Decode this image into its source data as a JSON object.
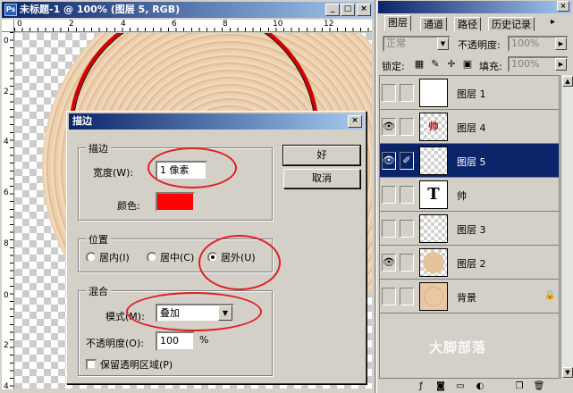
{
  "document": {
    "title": "未标题-1 @ 100% (图层 5, RGB)",
    "ruler_top": [
      "0",
      "2",
      "4",
      "6",
      "8",
      "10",
      "12"
    ],
    "ruler_left": [
      "0",
      "2",
      "4",
      "6",
      "8",
      "0",
      "2",
      "4"
    ],
    "watermark": "大脚部落"
  },
  "stroke_dialog": {
    "title": "描边",
    "ok_label": "好",
    "cancel_label": "取消",
    "stroke_group": {
      "label": "描边",
      "width_label": "宽度(W):",
      "width_value": "1 像素",
      "color_label": "颜色:",
      "color_value": "#ff0000"
    },
    "location_group": {
      "label": "位置",
      "options": [
        "居内(I)",
        "居中(C)",
        "居外(U)"
      ],
      "selected": "居外(U)"
    },
    "blending_group": {
      "label": "混合",
      "mode_label": "模式(M):",
      "mode_value": "叠加",
      "opacity_label": "不透明度(O):",
      "opacity_value": "100",
      "opacity_unit": "%",
      "preserve_label": "保留透明区域(P)"
    }
  },
  "layers_panel": {
    "tabs": [
      "图层",
      "通道",
      "路径",
      "历史记录"
    ],
    "active_tab": "图层",
    "blend_mode": "正常",
    "opacity_label": "不透明度:",
    "opacity_value": "100%",
    "lock_label": "锁定:",
    "fill_label": "填充:",
    "fill_value": "100%",
    "layers": [
      {
        "name": "图层 1",
        "visible": false,
        "selected": false,
        "thumb": "white-disc"
      },
      {
        "name": "图层 4",
        "visible": true,
        "selected": false,
        "thumb": "red-glyph",
        "thumb_text": "帅"
      },
      {
        "name": "图层 5",
        "visible": true,
        "selected": true,
        "thumb": "empty"
      },
      {
        "name": "帅",
        "visible": false,
        "selected": false,
        "thumb": "text",
        "thumb_text": "T"
      },
      {
        "name": "图层 3",
        "visible": false,
        "selected": false,
        "thumb": "empty"
      },
      {
        "name": "图层 2",
        "visible": true,
        "selected": false,
        "thumb": "wood-disc"
      },
      {
        "name": "背景",
        "visible": false,
        "selected": false,
        "thumb": "wood-fill",
        "locked": true
      }
    ]
  },
  "colors": {
    "titlebar_start": "#0a246a",
    "titlebar_end": "#a6caf0",
    "stroke_color": "#ff0000",
    "selection": "#0a246a"
  }
}
